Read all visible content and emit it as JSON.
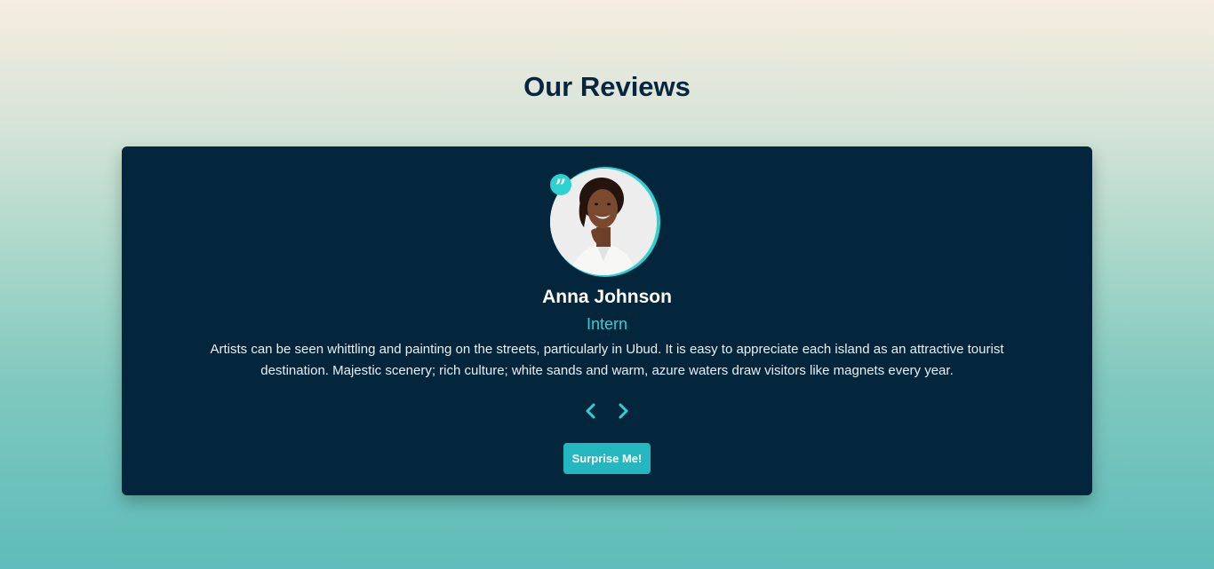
{
  "section": {
    "title": "Our Reviews"
  },
  "review": {
    "name": "Anna Johnson",
    "role": "Intern",
    "text": "Artists can be seen whittling and painting on the streets, particularly in Ubud. It is easy to appreciate each island as an attractive tourist destination. Majestic scenery; rich culture; white sands and warm, azure waters draw visitors like magnets every year.",
    "quote_glyph": "”"
  },
  "controls": {
    "prev_icon": "chevron-left-icon",
    "next_icon": "chevron-right-icon",
    "surprise_label": "Surprise Me!"
  },
  "colors": {
    "accent": "#2ed1cf",
    "card_background": "#04263d",
    "title": "#062540",
    "button": "#23b8bf"
  }
}
